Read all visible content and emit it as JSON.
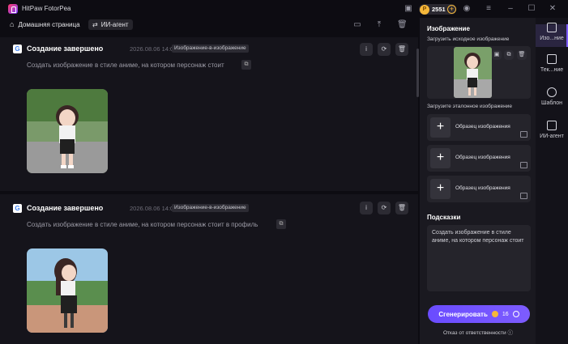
{
  "app": {
    "title": "HitPaw FotorPea"
  },
  "header": {
    "coins": "2551",
    "coin_glyph": "P"
  },
  "nav": {
    "home": "Домашняя страница",
    "agent": "ИИ-агент"
  },
  "cards": [
    {
      "title": "Создание завершено",
      "time": "2026.08.06  14:07:27",
      "tag": "Изображение-в-изображение",
      "prompt": "Создать изображение в стиле аниме, на котором персонаж стоит"
    },
    {
      "title": "Создание завершено",
      "time": "2026.08.06  14:06:51",
      "tag": "Изображение-в-изображение",
      "prompt": "Создать изображение в стиле аниме, на котором персонаж стоит в профиль"
    }
  ],
  "panel": {
    "heading": "Изображение",
    "upload_label": "Загрузить исходное изображение",
    "reference_label": "Загрузите эталонное изображение",
    "slots": [
      "Образец изображения",
      "Образец изображения",
      "Образец изображения"
    ],
    "hints_heading": "Подсказки",
    "hint_text": "Создать изображение в стиле аниме, на котором персонаж стоит",
    "generate_label": "Сгенерировать",
    "cost": "16",
    "disclaimer": "Отказ от ответственности"
  },
  "rail": [
    {
      "label": "Изо...ние"
    },
    {
      "label": "Тек...ние"
    },
    {
      "label": "Шаблон"
    },
    {
      "label": "ИИ-агент"
    }
  ],
  "colors": {
    "accent": "#7d5cff",
    "coin": "#f5b73a",
    "bg": "#0d0c12",
    "panel": "#1a1920"
  }
}
